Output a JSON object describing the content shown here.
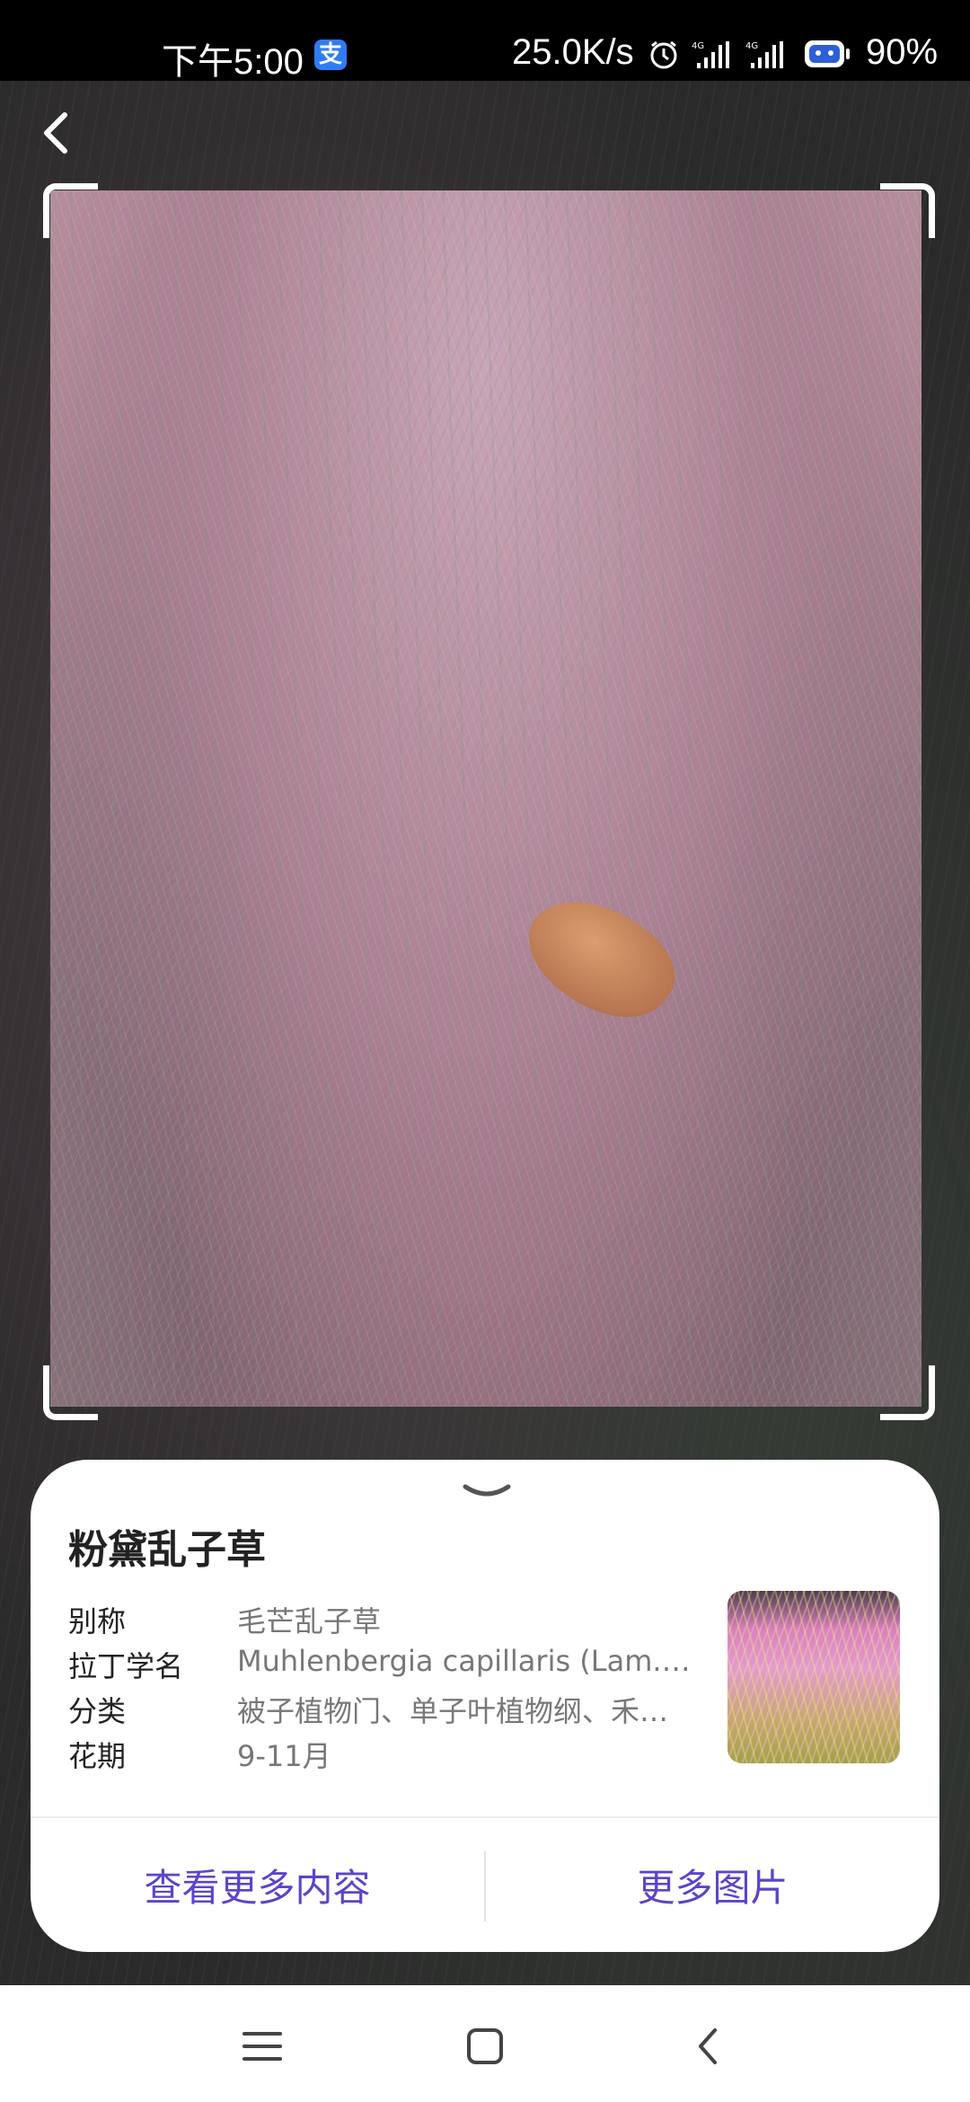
{
  "status_bar": {
    "time": "下午5:00",
    "app_badge": "支",
    "network_speed": "25.0K/s",
    "signal_1": "4G",
    "signal_2": "4G",
    "battery": "90%"
  },
  "plant": {
    "name": "粉黛乱子草",
    "attributes": [
      {
        "label": "别称",
        "value": "毛芒乱子草"
      },
      {
        "label": "拉丁学名",
        "value": "Muhlenbergia capillaris (Lam.) Trin."
      },
      {
        "label": "分类",
        "value": "被子植物门、单子叶植物纲、禾本目、禾本科、乱子草属"
      },
      {
        "label": "花期",
        "value": "9-11月"
      }
    ]
  },
  "actions": {
    "more_content": "查看更多内容",
    "more_images": "更多图片"
  },
  "icons": {
    "back": "chevron-left-icon",
    "collapse": "chevron-down-icon",
    "alarm": "alarm-icon",
    "battery": "battery-icon",
    "nav_menu": "menu-icon",
    "nav_home": "home-square-icon",
    "nav_back": "back-icon"
  },
  "colors": {
    "accent": "#5a45c9",
    "status_bar": "#000000",
    "card": "#ffffff"
  }
}
